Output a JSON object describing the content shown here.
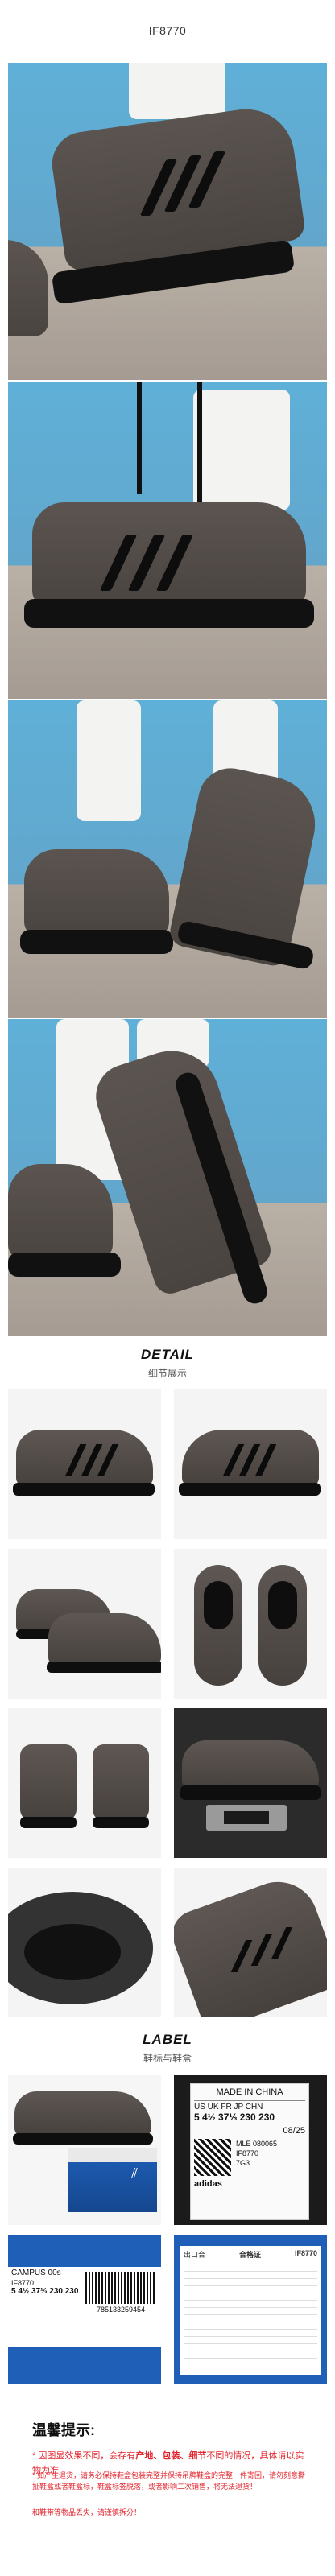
{
  "header": {
    "model_code": "IF8770"
  },
  "detail": {
    "title": "DETAIL",
    "subtitle": "细节展示"
  },
  "label": {
    "title": "LABEL",
    "subtitle": "鞋标与鞋盒"
  },
  "tongue_label": {
    "made_in": "MADE IN CHINA",
    "size_header": "US UK FR JP CHN",
    "size_values": "5 4½ 37⅓ 230 230",
    "date": "08/25",
    "code1": "MLE 080065",
    "code2": "IF8770",
    "code3": "7G3...",
    "brand": "adidas"
  },
  "box_label": {
    "size_row": "5  4½ 37⅓ 230 230",
    "name": "CAMPUS 00s",
    "article": "IF8770",
    "barcode": "785133259454"
  },
  "cert": {
    "left_title": "出口合",
    "code": "IF8770",
    "center": "合格证"
  },
  "notice": {
    "title": "温馨提示:",
    "line1_prefix": "* 因图显效果不同，会存有",
    "line1_bold": "产地、包装、细节",
    "line1_suffix": "不同的情况，具体请以实物为准!",
    "line2": "* 如产生退货，请务必保持鞋盒包装完整并保持吊牌鞋盒的完整一件寄回，请勿刻意撕扯鞋盒或者鞋盒标，鞋盒标签脱落，或者影响二次销售，将无法退货！",
    "line3": "和鞋带等物品丢失，请谨慎拆分！"
  },
  "colors": {
    "suede": "#5a5350",
    "sole": "#111111",
    "sky": "#5fb0d8",
    "accent_red": "#e0262e",
    "box_blue": "#1f5fb8"
  }
}
